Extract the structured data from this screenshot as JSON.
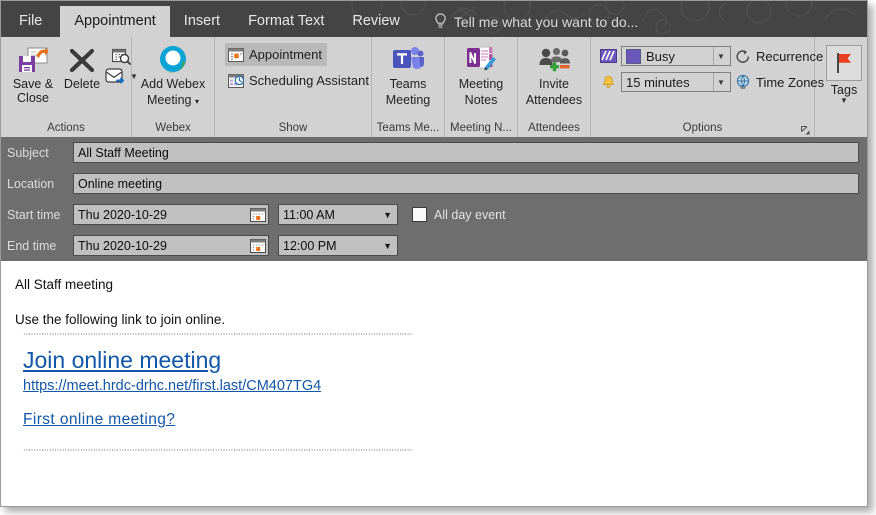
{
  "window": {
    "title": "Appointment"
  },
  "tabs": [
    {
      "label": "File",
      "active": false
    },
    {
      "label": "Appointment",
      "active": true
    },
    {
      "label": "Insert",
      "active": false
    },
    {
      "label": "Format Text",
      "active": false
    },
    {
      "label": "Review",
      "active": false
    }
  ],
  "tellme": {
    "placeholder": "Tell me what you want to do...",
    "icon": "lightbulb-icon"
  },
  "ribbon": {
    "groups": {
      "actions": {
        "label": "Actions",
        "save_close": "Save & Close",
        "save_close_line1": "Save &",
        "save_close_line2": "Close",
        "delete": "Delete",
        "icons": [
          "save-close-icon",
          "delete-x-icon",
          "calendar-search-icon",
          "forward-envelope-icon"
        ]
      },
      "webex": {
        "label": "Webex",
        "add_meeting_line1": "Add Webex",
        "add_meeting_line2": "Meeting",
        "add_meeting": "Add Webex Meeting",
        "icon": "webex-logo-icon"
      },
      "show": {
        "label": "Show",
        "appointment": "Appointment",
        "scheduling_assistant": "Scheduling Assistant",
        "appointment_icon": "appointment-calendar-icon",
        "scheduling_icon": "scheduling-clock-icon"
      },
      "teams": {
        "label": "Teams Me...",
        "button_line1": "Teams",
        "button_line2": "Meeting",
        "button": "Teams Meeting",
        "icon": "teams-icon"
      },
      "notes": {
        "label": "Meeting N...",
        "button_line1": "Meeting",
        "button_line2": "Notes",
        "button": "Meeting Notes",
        "icon": "onenote-icon"
      },
      "attendees": {
        "label": "Attendees",
        "button_line1": "Invite",
        "button_line2": "Attendees",
        "button": "Invite Attendees",
        "icon": "invite-attendees-icon"
      },
      "options": {
        "label": "Options",
        "busy_value": "Busy",
        "busy_color": "#6b56bc",
        "reminder_value": "15 minutes",
        "recurrence": "Recurrence",
        "time_zones": "Time Zones",
        "busy_icon": "show-as-icon",
        "reminder_icon": "bell-icon",
        "recurrence_icon": "recurrence-icon",
        "timezones_icon": "globe-icon",
        "dialog_launcher_icon": "dialog-launcher-icon"
      },
      "tags": {
        "label": "Tags",
        "icon": "red-flag-icon",
        "caret": "chevron-down-icon"
      }
    }
  },
  "form": {
    "subject": {
      "label": "Subject",
      "value": "All Staff Meeting"
    },
    "location": {
      "label": "Location",
      "value": "Online meeting"
    },
    "start_time": {
      "label": "Start time",
      "date": "Thu 2020-10-29",
      "time": "11:00 AM"
    },
    "end_time": {
      "label": "End time",
      "date": "Thu 2020-10-29",
      "time": "12:00 PM"
    },
    "all_day": {
      "label": "All day event",
      "checked": false
    },
    "calendar_icon": "calendar-picker-icon"
  },
  "body": {
    "line1": "All Staff meeting",
    "line2": "Use the following link to join online.",
    "join_link": "Join online meeting",
    "url_link": "https://meet.hrdc-drhc.net/first.last/CM407TG4",
    "first_link": "First online meeting?",
    "link_color": "#1257a8"
  }
}
